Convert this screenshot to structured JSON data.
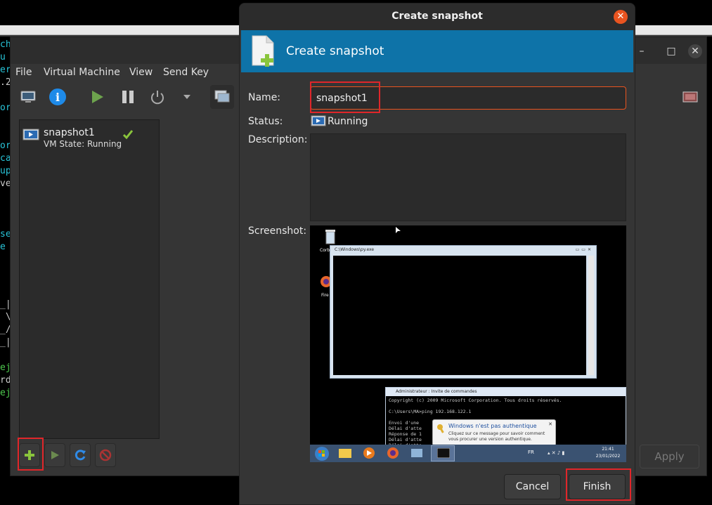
{
  "terminal_bg": {
    "fragments": [
      {
        "text": "ch",
        "color": "#28c4d8"
      },
      {
        "text": "u",
        "color": "#28c4d8"
      },
      {
        "text": "er",
        "color": "#28c4d8"
      },
      {
        "text": ".2",
        "color": "#cccccc"
      },
      {
        "text": "or",
        "color": "#28c4d8"
      },
      {
        "text": "or",
        "color": "#28c4d8"
      },
      {
        "text": "ca",
        "color": "#28c4d8"
      },
      {
        "text": "up",
        "color": "#28c4d8"
      },
      {
        "text": "ve",
        "color": "#cccccc"
      },
      {
        "text": "se",
        "color": "#28c4d8"
      },
      {
        "text": "e",
        "color": "#28c4d8"
      },
      {
        "text": "_|",
        "color": "#cccccc"
      },
      {
        "text": " \\",
        "color": "#cccccc"
      },
      {
        "text": "_/",
        "color": "#cccccc"
      },
      {
        "text": "_|",
        "color": "#cccccc"
      },
      {
        "text": "ej",
        "color": "#4ec94e"
      },
      {
        "text": "rd",
        "color": "#cccccc"
      },
      {
        "text": "ej",
        "color": "#4ec94e"
      }
    ]
  },
  "vm_window": {
    "menu": [
      "File",
      "Virtual Machine",
      "View",
      "Send Key"
    ],
    "snapshot_item": {
      "name": "snapshot1",
      "state": "VM State: Running"
    },
    "apply_label": "Apply"
  },
  "dialog": {
    "title": "Create snapshot",
    "banner_title": "Create snapshot",
    "name_label": "Name:",
    "name_value": "snapshot1",
    "status_label": "Status:",
    "status_value": "Running",
    "description_label": "Description:",
    "screenshot_label": "Screenshot:",
    "cancel_label": "Cancel",
    "finish_label": "Finish"
  },
  "screenshot": {
    "desktop_icons": [
      "Corb",
      "Fire"
    ],
    "window1_title": "C:\\Windows\\py.exe",
    "window2_title": "Administrateur : Invite de commandes",
    "console_lines": [
      "Copyright (c) 2009 Microsoft Corporation. Tous droits réservés.",
      "",
      "C:\\Users\\MA>ping 192.168.122.1",
      "",
      "Envoi d'une                             ts de données :",
      "Délai d'atte",
      "Réponse de 1                             te de destination.",
      "Délai d'atte",
      "Délai d'atte"
    ],
    "notification_title": "Windows n'est pas authentique",
    "notification_body": "Cliquez sur ce message pour savoir comment vous procurer une version authentique.",
    "taskbar_lang": "FR",
    "clock_time": "21:41",
    "clock_date": "23/01/2022"
  },
  "colors": {
    "accent": "#e95420",
    "banner": "#0e73a8",
    "highlight": "#e0262a"
  }
}
